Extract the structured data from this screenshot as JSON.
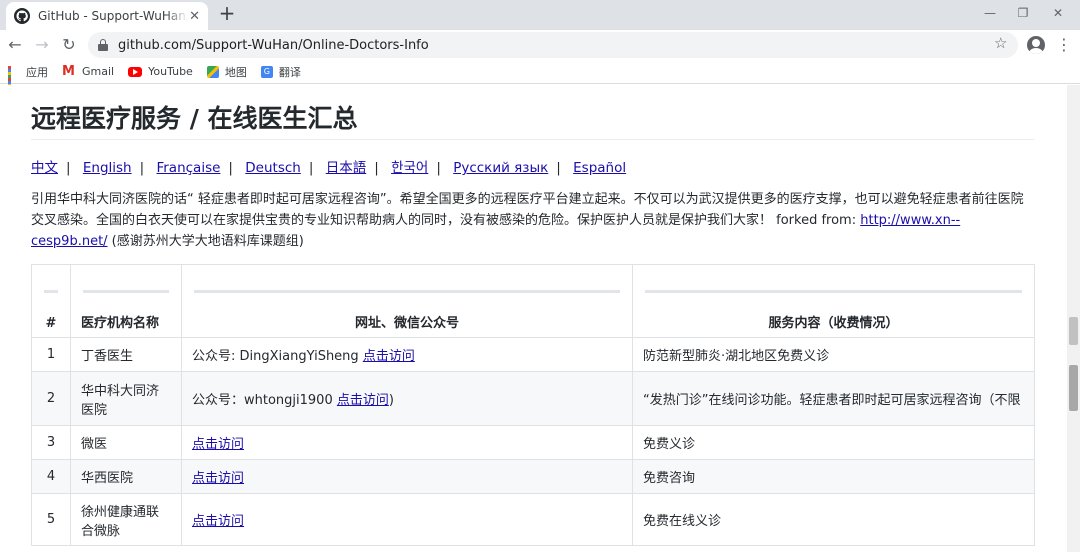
{
  "browser": {
    "tab_title": "GitHub - Support-WuHan/Onl",
    "tab_close": "✕",
    "new_tab": "+",
    "window_controls": {
      "minimize": "—",
      "restore": "❐",
      "close": "✕"
    },
    "nav": {
      "back": "←",
      "forward": "→",
      "reload": "↻"
    },
    "url": "github.com/Support-WuHan/Online-Doctors-Info",
    "star": "☆",
    "menu": "⋮",
    "bookmarks": [
      {
        "label": "应用",
        "icon": "apps-grid-icon"
      },
      {
        "label": "Gmail",
        "icon": "gmail-icon"
      },
      {
        "label": "YouTube",
        "icon": "youtube-icon"
      },
      {
        "label": "地图",
        "icon": "maps-icon"
      },
      {
        "label": "翻译",
        "icon": "translate-icon"
      }
    ]
  },
  "readme": {
    "title": "远程医疗服务 / 在线医生汇总",
    "languages": [
      "中文",
      "English",
      "Française",
      "Deutsch",
      "日本語",
      "한국어",
      "Русский язык",
      "Español"
    ],
    "language_separator": "|",
    "intro_text": "引用华中科大同济医院的话“ 轻症患者即时起可居家远程咨询”。希望全国更多的远程医疗平台建立起来。不仅可以为武汉提供更多的医疗支撑，也可以避免轻症患者前往医院交叉感染。全国的白衣天使可以在家提供宝贵的专业知识帮助病人的同时，没有被感染的危险。保护医护人员就是保护我们大家！ forked from: ",
    "intro_link": "http://www.xn--cesp9b.net/",
    "intro_suffix": " (感谢苏州大学大地语料库课题组)",
    "table": {
      "headers": [
        "#",
        "医疗机构名称",
        "网址、微信公众号",
        "服务内容（收费情况）"
      ],
      "rows": [
        {
          "num": "1",
          "org": "丁香医生",
          "web_prefix": "公众号: DingXiangYiSheng ",
          "web_link": "点击访问",
          "web_suffix": "",
          "service": "防范新型肺炎·湖北地区免费义诊"
        },
        {
          "num": "2",
          "org": "华中科大同济医院",
          "web_prefix": "公众号：whtongji1900 ",
          "web_link": "点击访问",
          "web_suffix": ")",
          "service": "“发热门诊”在线问诊功能。轻症患者即时起可居家远程咨询（不限"
        },
        {
          "num": "3",
          "org": "微医",
          "web_prefix": "",
          "web_link": "点击访问",
          "web_suffix": "",
          "service": "免费义诊"
        },
        {
          "num": "4",
          "org": "华西医院",
          "web_prefix": "",
          "web_link": "点击访问",
          "web_suffix": "",
          "service": "免费咨询"
        },
        {
          "num": "5",
          "org": "徐州健康通联合微脉",
          "web_prefix": "",
          "web_link": "点击访问",
          "web_suffix": "",
          "service": "免费在线义诊"
        }
      ]
    }
  }
}
